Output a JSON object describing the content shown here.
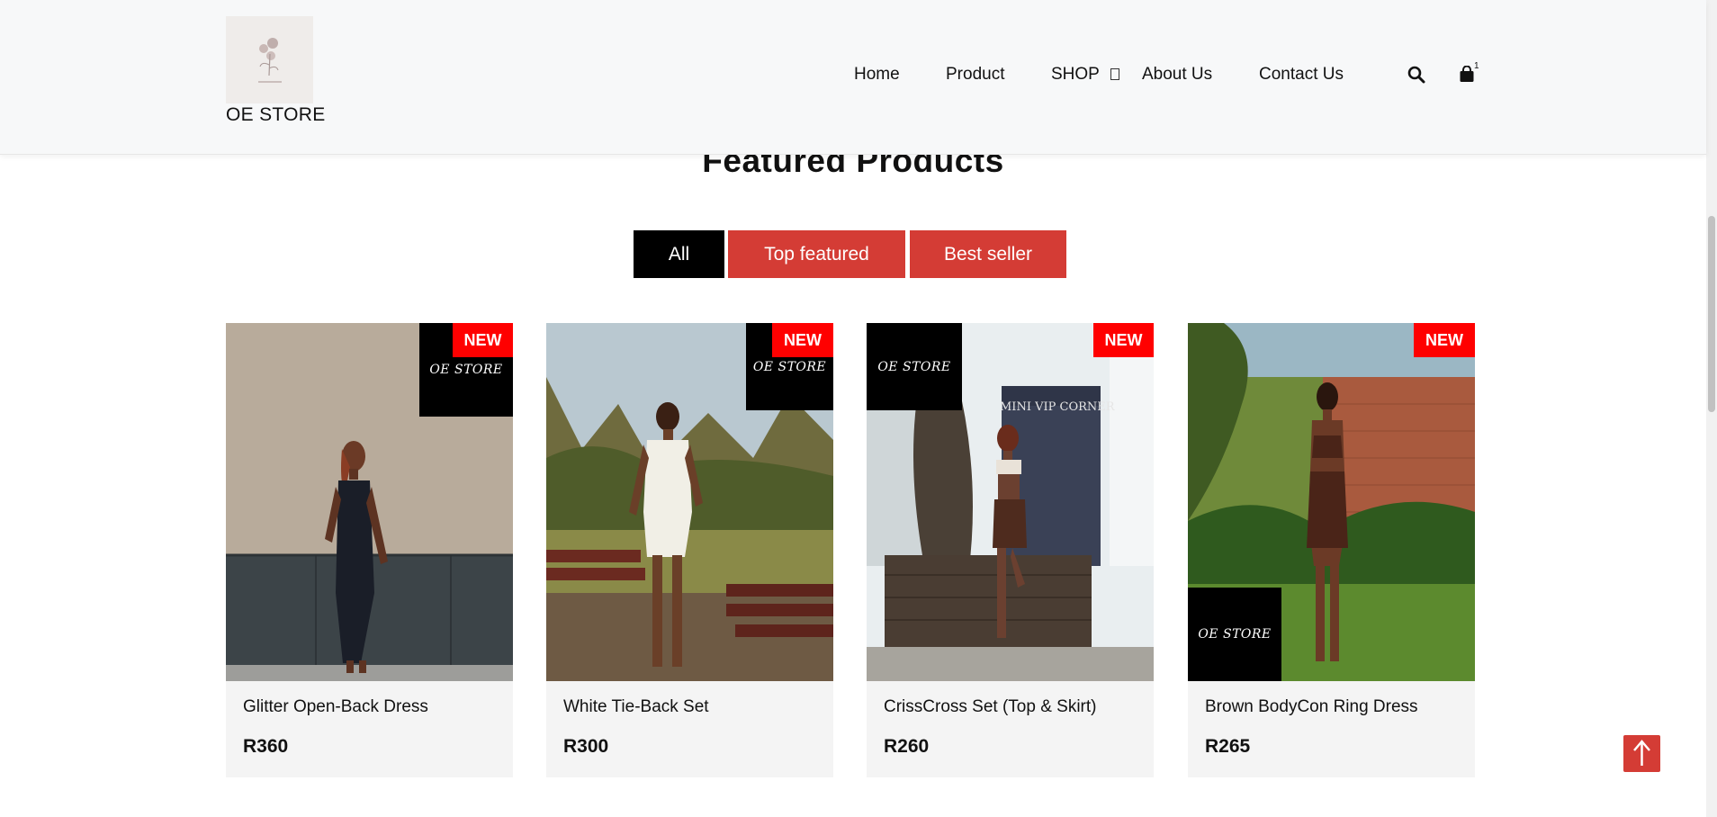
{
  "header": {
    "logo_text": "OE STORE",
    "nav": [
      {
        "label": "Home"
      },
      {
        "label": "Product"
      },
      {
        "label": "SHOP"
      },
      {
        "label": "About Us"
      },
      {
        "label": "Contact Us"
      }
    ],
    "cart_count": "1",
    "icons": {
      "search": "search-icon",
      "cart": "shopping-bag-icon",
      "shop_dropdown": "dropdown-box-icon"
    }
  },
  "section": {
    "title": "Featured Products",
    "filters": [
      {
        "label": "All",
        "active": true
      },
      {
        "label": "Top featured",
        "active": false
      },
      {
        "label": "Best seller",
        "active": false
      }
    ]
  },
  "products": [
    {
      "name": "Glitter Open-Back Dress",
      "price": "R360",
      "badge": "NEW",
      "brand": "OE STORE"
    },
    {
      "name": "White Tie-Back Set",
      "price": "R300",
      "badge": "NEW",
      "brand": "OE STORE"
    },
    {
      "name": "CrissCross Set (Top & Skirt)",
      "price": "R260",
      "badge": "NEW",
      "brand": "OE STORE",
      "sign": "MINI VIP CORNER"
    },
    {
      "name": "Brown BodyCon Ring Dress",
      "price": "R265",
      "badge": "NEW",
      "brand": "OE STORE"
    }
  ],
  "colors": {
    "accent": "#d43c35",
    "badge": "#ff0000",
    "active_filter": "#000000",
    "header_bg": "#f7f8f9"
  }
}
